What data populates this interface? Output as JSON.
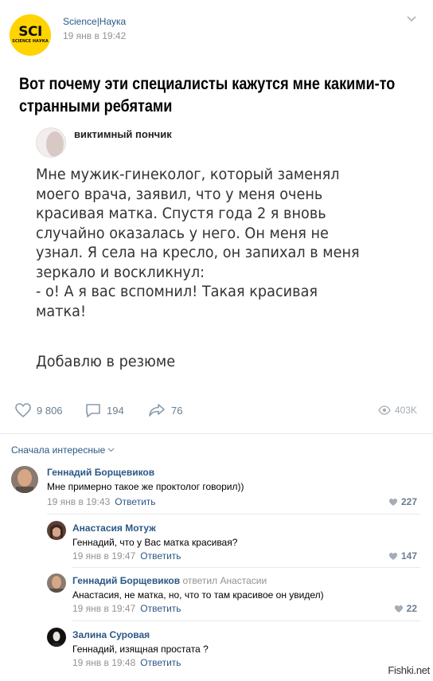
{
  "header": {
    "logo_text": "SCI",
    "logo_subtext": "SCIENCE НАУКА",
    "author": "Science|Наука",
    "date": "19 янв в 19:42"
  },
  "post": {
    "title": "Вот почему эти специалисты кажутся мне какими-то странными ребятами",
    "card": {
      "author": "виктимный пончик",
      "text": "Мне мужик-гинеколог, который заменял\nмоего врача, заявил, что у меня очень\nкрасивая матка. Спустя года 2 я вновь\nслучайно оказалась у него. Он меня не\nузнал. Я села на кресло, он запихал в меня\nзеркало и воскликнул:\n- о! А я вас вспомнил! Такая красивая\nматка!",
      "text2": "Добавлю в резюме"
    }
  },
  "actions": {
    "likes": "9 806",
    "comments": "194",
    "shares": "76",
    "views": "403K"
  },
  "comments_sort": "Сначала интересные",
  "comments": [
    {
      "name": "Геннадий Борщевиков",
      "replied": "",
      "text": "Мне примерно такое же проктолог говорил))",
      "date": "19 янв в 19:43",
      "reply": "Ответить",
      "likes": "227"
    },
    {
      "name": "Анастасия Мотуж",
      "replied": "",
      "text": "Геннадий, что у Вас матка красивая?",
      "date": "19 янв в 19:47",
      "reply": "Ответить",
      "likes": "147"
    },
    {
      "name": "Геннадий Борщевиков",
      "replied": "ответил Анастасии",
      "text": "Анастасия, не матка, но, что то там красивое он увидел)",
      "date": "19 янв в 19:47",
      "reply": "Ответить",
      "likes": "22"
    },
    {
      "name": "Залина Суровая",
      "replied": "",
      "text": "Геннадий, изящная простата ?",
      "date": "19 янв в 19:48",
      "reply": "Ответить",
      "likes": ""
    }
  ],
  "watermark": "Fishki.net"
}
